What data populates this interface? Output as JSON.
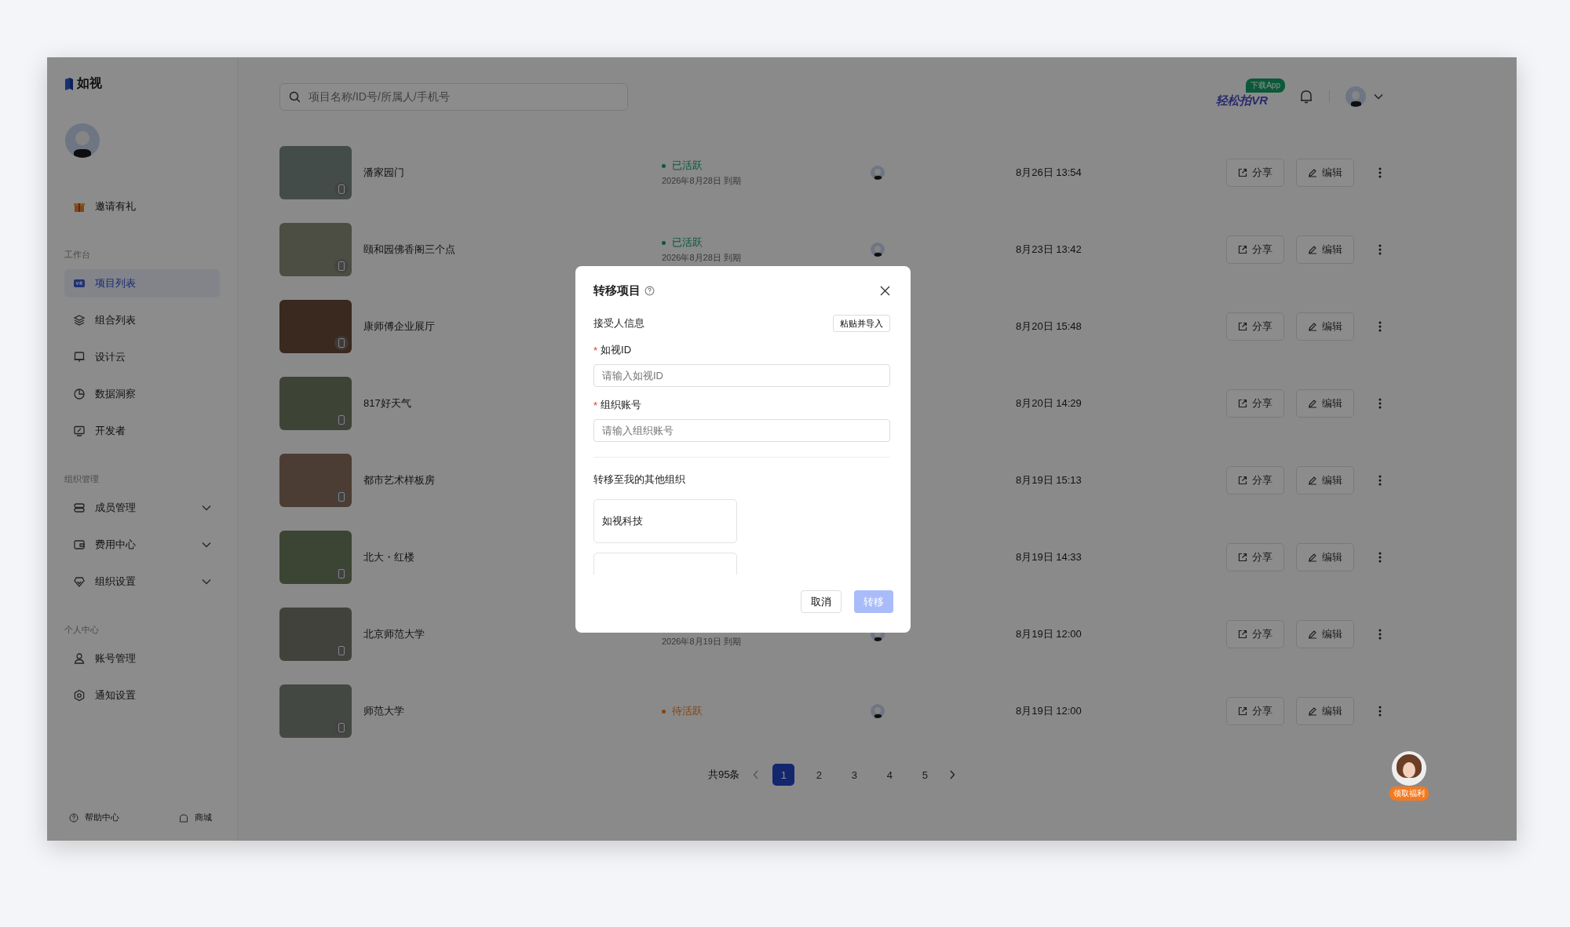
{
  "app": {
    "logo": "如视"
  },
  "sidebar": {
    "invite": "邀请有礼",
    "sections": [
      {
        "heading": "工作台",
        "items": [
          {
            "label": "项目列表",
            "selected": true
          },
          {
            "label": "组合列表",
            "selected": false
          },
          {
            "label": "设计云",
            "selected": false
          },
          {
            "label": "数据洞察",
            "selected": false
          },
          {
            "label": "开发者",
            "selected": false
          }
        ]
      },
      {
        "heading": "组织管理",
        "items": [
          {
            "label": "成员管理",
            "selected": false,
            "expanded": false
          },
          {
            "label": "费用中心",
            "selected": false,
            "expanded": false
          },
          {
            "label": "组织设置",
            "selected": false,
            "expanded": false
          }
        ]
      },
      {
        "heading": "个人中心",
        "items": [
          {
            "label": "账号管理",
            "selected": false
          },
          {
            "label": "通知设置",
            "selected": false
          }
        ]
      }
    ],
    "footer": [
      {
        "label": "帮助中心"
      },
      {
        "label": "商城"
      }
    ]
  },
  "topbar": {
    "search": {
      "placeholder": "项目名称/ID号/所属人/手机号"
    },
    "promo": "轻松拍VR",
    "promo_badge": "下载App"
  },
  "projects": [
    {
      "name": "潘家园门",
      "status": {
        "kind": "active",
        "label": "已活跃"
      },
      "expiry": "2026年8月28日 到期",
      "updated": "8月26日 13:54",
      "share": "分享",
      "edit": "编辑"
    },
    {
      "name": "颐和园佛香阁三个点",
      "status": {
        "kind": "active",
        "label": "已活跃"
      },
      "expiry": "2026年8月28日 到期",
      "updated": "8月23日 13:42",
      "share": "分享",
      "edit": "编辑"
    },
    {
      "name": "康师傅企业展厅",
      "updated": "8月20日 15:48",
      "share": "分享",
      "edit": "编辑"
    },
    {
      "name": "817好天气",
      "updated": "8月20日 14:29",
      "share": "分享",
      "edit": "编辑"
    },
    {
      "name": "都市艺术样板房",
      "updated": "8月19日 15:13",
      "share": "分享",
      "edit": "编辑"
    },
    {
      "name": "北大・红楼",
      "updated": "8月19日 14:33",
      "share": "分享",
      "edit": "编辑"
    },
    {
      "name": "北京师范大学",
      "expiry": "2026年8月19日 到期",
      "updated": "8月19日 12:00",
      "share": "分享",
      "edit": "编辑"
    },
    {
      "name": "师范大学",
      "status": {
        "kind": "pending",
        "label": "待活跃"
      },
      "updated": "8月19日 12:00",
      "share": "分享",
      "edit": "编辑"
    }
  ],
  "pagination": {
    "total": "共95条",
    "pages": [
      {
        "label": "1",
        "selected": true
      },
      {
        "label": "2",
        "selected": false
      },
      {
        "label": "3",
        "selected": false
      },
      {
        "label": "4",
        "selected": false
      },
      {
        "label": "5",
        "selected": false
      }
    ]
  },
  "helper": {
    "badge": "领取福利"
  },
  "modal": {
    "title": "转移项目",
    "section": "接受人信息",
    "paste_button": "粘贴并导入",
    "fields": [
      {
        "label": "如视ID",
        "required_mark": "*",
        "placeholder": "请输入如视ID"
      },
      {
        "label": "组织账号",
        "required_mark": "*",
        "placeholder": "请输入组织账号"
      }
    ],
    "orgs_heading": "转移至我的其他组织",
    "orgs": [
      {
        "name": "如视科技"
      }
    ],
    "orgs_clipped": true,
    "cancel": "取消",
    "confirm": {
      "label": "转移",
      "disabled": true
    }
  }
}
